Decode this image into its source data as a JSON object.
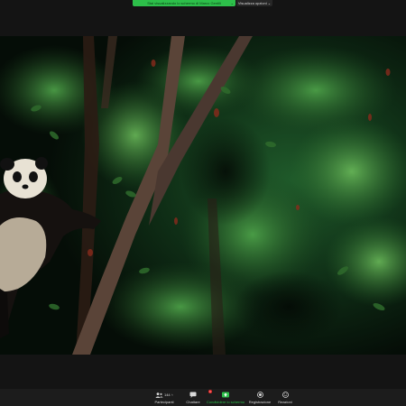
{
  "window": {
    "share_banner_text": "Stai visualizzando lo schermo di Marco Gentili",
    "view_options_label": "Visualizza opzioni",
    "view_options_caret": "⌄"
  },
  "toolbar": {
    "participants_count": "144",
    "participants_label": "Partecipanti",
    "chat_label": "Chattare",
    "chat_badge": "1",
    "share_label": "Condividere lo schermo",
    "record_label": "Registrazione",
    "reactions_label": "Reazioni"
  },
  "colors": {
    "share_green": "#2dbf4a",
    "toolbar_bg": "#1c1c1c",
    "notification_red": "#e02828"
  },
  "icons": [
    "people-icon",
    "chat-icon",
    "share-screen-icon",
    "record-icon",
    "smiley-icon"
  ]
}
